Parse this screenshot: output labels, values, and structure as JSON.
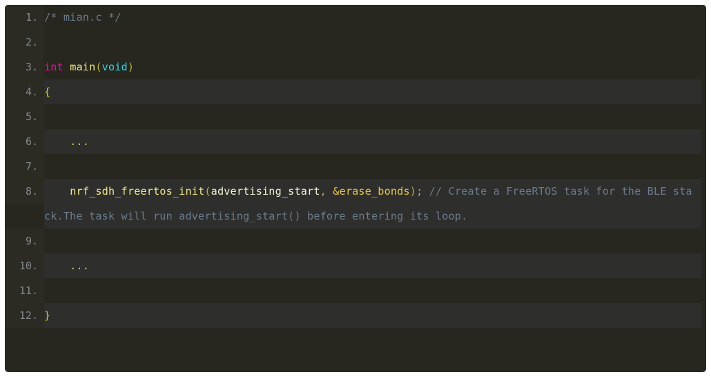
{
  "editor": {
    "language": "c",
    "filename": "mian.c",
    "theme": "dark",
    "colors": {
      "background": "#27271f",
      "stripe": "#2e2e2c",
      "gutter": "#2b2b24",
      "line_number": "#83898d",
      "comment": "#6a7c8c",
      "keyword": "#ff00b2",
      "type": "#29d9f5",
      "function": "#f0e68c",
      "identifier": "#f2f2d2",
      "gold": "#e8c547",
      "punctuation": "#b5b52b",
      "page": "#ffffff"
    },
    "lines": [
      {
        "number": "1.",
        "striped": false,
        "tokens": [
          {
            "text": "/* mian.c */",
            "kind": "comment"
          }
        ]
      },
      {
        "number": "2.",
        "striped": true,
        "tokens": [
          {
            "text": "",
            "kind": "plain"
          }
        ]
      },
      {
        "number": "3.",
        "striped": false,
        "tokens": [
          {
            "text": "int",
            "kind": "keyword"
          },
          {
            "text": " ",
            "kind": "plain"
          },
          {
            "text": "main",
            "kind": "func"
          },
          {
            "text": "(",
            "kind": "punct"
          },
          {
            "text": "void",
            "kind": "type"
          },
          {
            "text": ")",
            "kind": "punct"
          }
        ]
      },
      {
        "number": "4.",
        "striped": true,
        "tokens": [
          {
            "text": "{",
            "kind": "brace"
          }
        ]
      },
      {
        "number": "5.",
        "striped": false,
        "tokens": [
          {
            "text": "",
            "kind": "plain"
          }
        ]
      },
      {
        "number": "6.",
        "striped": true,
        "tokens": [
          {
            "text": "    ",
            "kind": "plain"
          },
          {
            "text": "...",
            "kind": "dots"
          }
        ]
      },
      {
        "number": "7.",
        "striped": false,
        "tokens": [
          {
            "text": "",
            "kind": "plain"
          }
        ]
      },
      {
        "number": "8.",
        "striped": true,
        "tokens": [
          {
            "text": "    ",
            "kind": "plain"
          },
          {
            "text": "nrf_sdh_freertos_init",
            "kind": "func"
          },
          {
            "text": "(",
            "kind": "punct"
          },
          {
            "text": "advertising_start",
            "kind": "ident"
          },
          {
            "text": ", ",
            "kind": "punct"
          },
          {
            "text": "&erase_bonds",
            "kind": "gold"
          },
          {
            "text": ");",
            "kind": "punct"
          },
          {
            "text": " ",
            "kind": "plain"
          },
          {
            "text": "// Create a FreeRTOS task for the BLE stack.The task will run advertising_start() before entering its loop.",
            "kind": "comment"
          }
        ]
      },
      {
        "number": "9.",
        "striped": false,
        "tokens": [
          {
            "text": "",
            "kind": "plain"
          }
        ]
      },
      {
        "number": "10.",
        "striped": true,
        "tokens": [
          {
            "text": "    ",
            "kind": "plain"
          },
          {
            "text": "...",
            "kind": "dots"
          }
        ]
      },
      {
        "number": "11.",
        "striped": false,
        "tokens": [
          {
            "text": "",
            "kind": "plain"
          }
        ]
      },
      {
        "number": "12.",
        "striped": true,
        "tokens": [
          {
            "text": "}",
            "kind": "brace"
          }
        ]
      }
    ]
  }
}
